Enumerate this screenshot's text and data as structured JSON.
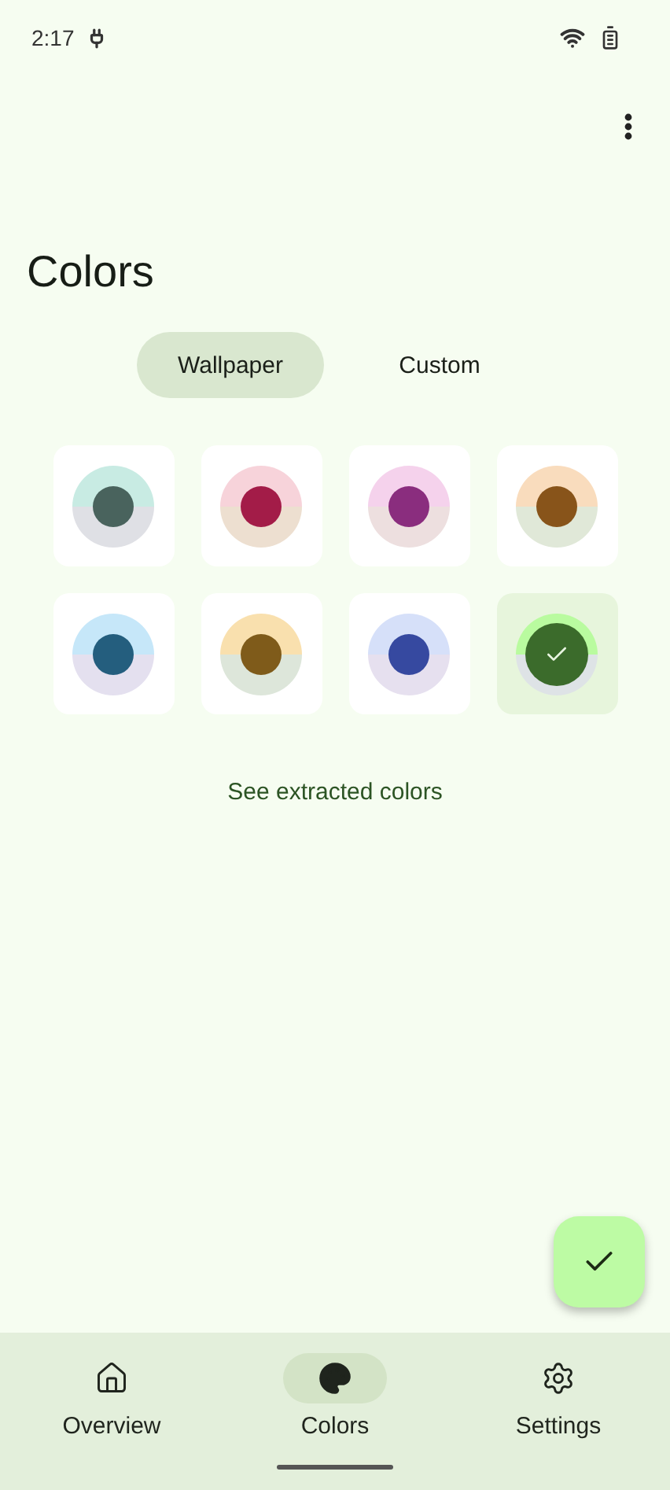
{
  "status_bar": {
    "time": "2:17"
  },
  "title": "Colors",
  "tabs": [
    {
      "label": "Wallpaper",
      "selected": true
    },
    {
      "label": "Custom",
      "selected": false
    }
  ],
  "swatches": [
    {
      "color": "#49635d",
      "ring": [
        {
          "color": "#c8ebe3"
        },
        {
          "color": "#dfe0e5"
        }
      ],
      "selected": false
    },
    {
      "color": "#a31c48",
      "ring": [
        {
          "color": "#f7d3da"
        },
        {
          "color": "#eddfd0"
        }
      ],
      "selected": false
    },
    {
      "color": "#8a2d7e",
      "ring": [
        {
          "color": "#f5d2ec"
        },
        {
          "color": "#eddfdf"
        }
      ],
      "selected": false
    },
    {
      "color": "#88541a",
      "ring": [
        {
          "color": "#f9dcbd"
        },
        {
          "color": "#e0e8d8"
        }
      ],
      "selected": false
    },
    {
      "color": "#245e7e",
      "ring": [
        {
          "color": "#c6e7f9"
        },
        {
          "color": "#e4e0ef"
        }
      ],
      "selected": false
    },
    {
      "color": "#7f5b1a",
      "ring": [
        {
          "color": "#f9e0ae"
        },
        {
          "color": "#dde6da"
        }
      ],
      "selected": false
    },
    {
      "color": "#3649a0",
      "ring": [
        {
          "color": "#d6e0f9"
        },
        {
          "color": "#e6e0ef"
        }
      ],
      "selected": false
    },
    {
      "color": "#3b6b2b",
      "ring": [
        {
          "color": "#b9fb9f"
        },
        {
          "color": "#dee3e6"
        }
      ],
      "selected": true
    }
  ],
  "link": "See extracted colors",
  "nav": [
    {
      "label": "Overview",
      "selected": false
    },
    {
      "label": "Colors",
      "selected": true
    },
    {
      "label": "Settings",
      "selected": false
    }
  ]
}
